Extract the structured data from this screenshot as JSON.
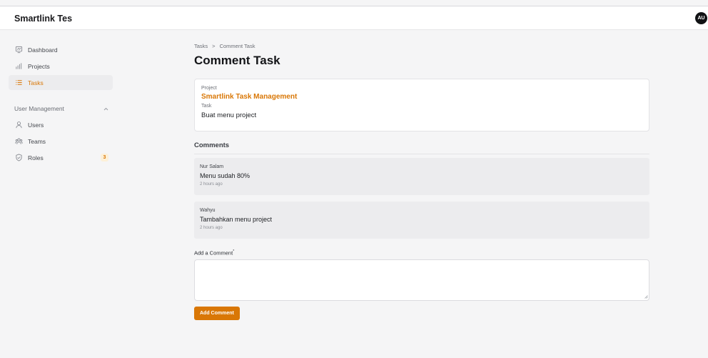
{
  "app": {
    "title": "Smartlink Tes",
    "avatar_initials": "AU"
  },
  "sidebar": {
    "items": [
      {
        "label": "Dashboard",
        "icon": "dashboard-icon",
        "active": false
      },
      {
        "label": "Projects",
        "icon": "bar-chart-icon",
        "active": false
      },
      {
        "label": "Tasks",
        "icon": "list-icon",
        "active": true
      }
    ],
    "group": {
      "label": "User Management",
      "expanded": true,
      "items": [
        {
          "label": "Users",
          "icon": "user-icon"
        },
        {
          "label": "Teams",
          "icon": "users-group-icon"
        },
        {
          "label": "Roles",
          "icon": "shield-check-icon",
          "badge": "3"
        }
      ]
    }
  },
  "breadcrumb": {
    "parent": "Tasks",
    "separator": ">",
    "current": "Comment Task"
  },
  "page": {
    "title": "Comment Task"
  },
  "task_card": {
    "project_label": "Project",
    "project_value": "Smartlink Task Management",
    "task_label": "Task",
    "task_value": "Buat menu project"
  },
  "comments": {
    "title": "Comments",
    "items": [
      {
        "author": "Nur Salam",
        "text": "Menu sudah 80%",
        "time": "2 hours ago"
      },
      {
        "author": "Wahyu",
        "text": "Tambahkan menu project",
        "time": "2 hours ago"
      }
    ]
  },
  "form": {
    "label": "Add a Comment",
    "required_mark": "*",
    "value": "",
    "submit_label": "Add Comment"
  },
  "colors": {
    "accent": "#d97706",
    "background": "#f5f5f6",
    "active_bg": "#ececee"
  }
}
